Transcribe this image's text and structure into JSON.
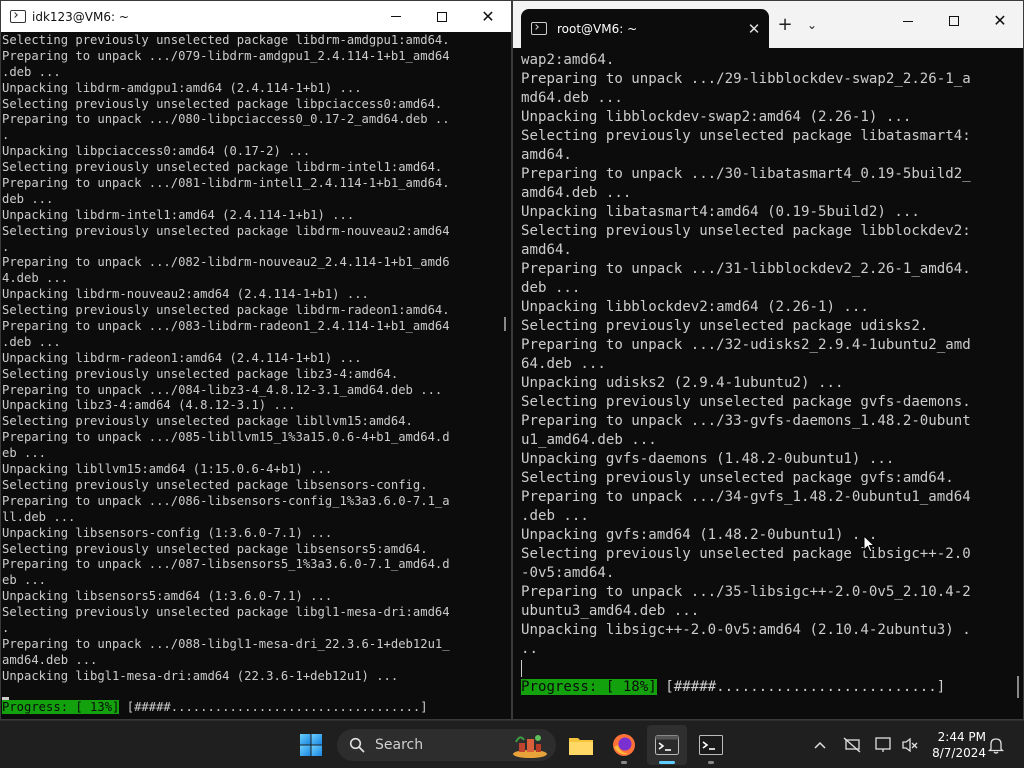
{
  "left_window": {
    "title": "idk123@VM6: ~",
    "lines": [
      "Selecting previously unselected package libdrm-amdgpu1:amd64.",
      "Preparing to unpack .../079-libdrm-amdgpu1_2.4.114-1+b1_amd64",
      ".deb ...",
      "Unpacking libdrm-amdgpu1:amd64 (2.4.114-1+b1) ...",
      "Selecting previously unselected package libpciaccess0:amd64.",
      "Preparing to unpack .../080-libpciaccess0_0.17-2_amd64.deb ..",
      ".",
      "Unpacking libpciaccess0:amd64 (0.17-2) ...",
      "Selecting previously unselected package libdrm-intel1:amd64.",
      "Preparing to unpack .../081-libdrm-intel1_2.4.114-1+b1_amd64.",
      "deb ...",
      "Unpacking libdrm-intel1:amd64 (2.4.114-1+b1) ...",
      "Selecting previously unselected package libdrm-nouveau2:amd64",
      ".",
      "Preparing to unpack .../082-libdrm-nouveau2_2.4.114-1+b1_amd6",
      "4.deb ...",
      "Unpacking libdrm-nouveau2:amd64 (2.4.114-1+b1) ...",
      "Selecting previously unselected package libdrm-radeon1:amd64.",
      "Preparing to unpack .../083-libdrm-radeon1_2.4.114-1+b1_amd64",
      ".deb ...",
      "Unpacking libdrm-radeon1:amd64 (2.4.114-1+b1) ...",
      "Selecting previously unselected package libz3-4:amd64.",
      "Preparing to unpack .../084-libz3-4_4.8.12-3.1_amd64.deb ...",
      "Unpacking libz3-4:amd64 (4.8.12-3.1) ...",
      "Selecting previously unselected package libllvm15:amd64.",
      "Preparing to unpack .../085-libllvm15_1%3a15.0.6-4+b1_amd64.d",
      "eb ...",
      "Unpacking libllvm15:amd64 (1:15.0.6-4+b1) ...",
      "Selecting previously unselected package libsensors-config.",
      "Preparing to unpack .../086-libsensors-config_1%3a3.6.0-7.1_a",
      "ll.deb ...",
      "Unpacking libsensors-config (1:3.6.0-7.1) ...",
      "Selecting previously unselected package libsensors5:amd64.",
      "Preparing to unpack .../087-libsensors5_1%3a3.6.0-7.1_amd64.d",
      "eb ...",
      "Unpacking libsensors5:amd64 (1:3.6.0-7.1) ...",
      "Selecting previously unselected package libgl1-mesa-dri:amd64",
      ".",
      "Preparing to unpack .../088-libgl1-mesa-dri_22.3.6-1+deb12u1_",
      "amd64.deb ...",
      "Unpacking libgl1-mesa-dri:amd64 (22.3.6-1+deb12u1) ..."
    ],
    "progress_label": "Progress: [ 13%]",
    "progress_bar": " [#####..................................]",
    "progress_fraction": 0.13
  },
  "right_window": {
    "tab_title": "root@VM6: ~",
    "lines": [
      "wap2:amd64.",
      "Preparing to unpack .../29-libblockdev-swap2_2.26-1_a",
      "md64.deb ...",
      "Unpacking libblockdev-swap2:amd64 (2.26-1) ...",
      "Selecting previously unselected package libatasmart4:",
      "amd64.",
      "Preparing to unpack .../30-libatasmart4_0.19-5build2_",
      "amd64.deb ...",
      "Unpacking libatasmart4:amd64 (0.19-5build2) ...",
      "Selecting previously unselected package libblockdev2:",
      "amd64.",
      "Preparing to unpack .../31-libblockdev2_2.26-1_amd64.",
      "deb ...",
      "Unpacking libblockdev2:amd64 (2.26-1) ...",
      "Selecting previously unselected package udisks2.",
      "Preparing to unpack .../32-udisks2_2.9.4-1ubuntu2_amd",
      "64.deb ...",
      "Unpacking udisks2 (2.9.4-1ubuntu2) ...",
      "Selecting previously unselected package gvfs-daemons.",
      "Preparing to unpack .../33-gvfs-daemons_1.48.2-0ubunt",
      "u1_amd64.deb ...",
      "Unpacking gvfs-daemons (1.48.2-0ubuntu1) ...",
      "Selecting previously unselected package gvfs:amd64.",
      "Preparing to unpack .../34-gvfs_1.48.2-0ubuntu1_amd64",
      ".deb ...",
      "Unpacking gvfs:amd64 (1.48.2-0ubuntu1) ...",
      "Selecting previously unselected package libsigc++-2.0",
      "-0v5:amd64.",
      "Preparing to unpack .../35-libsigc++-2.0-0v5_2.10.4-2",
      "ubuntu3_amd64.deb ...",
      "Unpacking libsigc++-2.0-0v5:amd64 (2.10.4-2ubuntu3) .",
      ".."
    ],
    "progress_label": "Progress: [ 18%]",
    "progress_bar": " [#####..........................]",
    "progress_fraction": 0.18
  },
  "taskbar": {
    "search_label": "Search",
    "time": "2:44 PM",
    "date": "8/7/2024",
    "apps": [
      "file-explorer-icon",
      "firefox-icon",
      "terminal-icon",
      "console-icon"
    ]
  },
  "colors": {
    "console_bg": "#0c0c0c",
    "console_fg": "#cccccc",
    "progress_green": "#13a10e",
    "taskbar_bg": "#1f1f1f",
    "accent": "#60cdff"
  }
}
